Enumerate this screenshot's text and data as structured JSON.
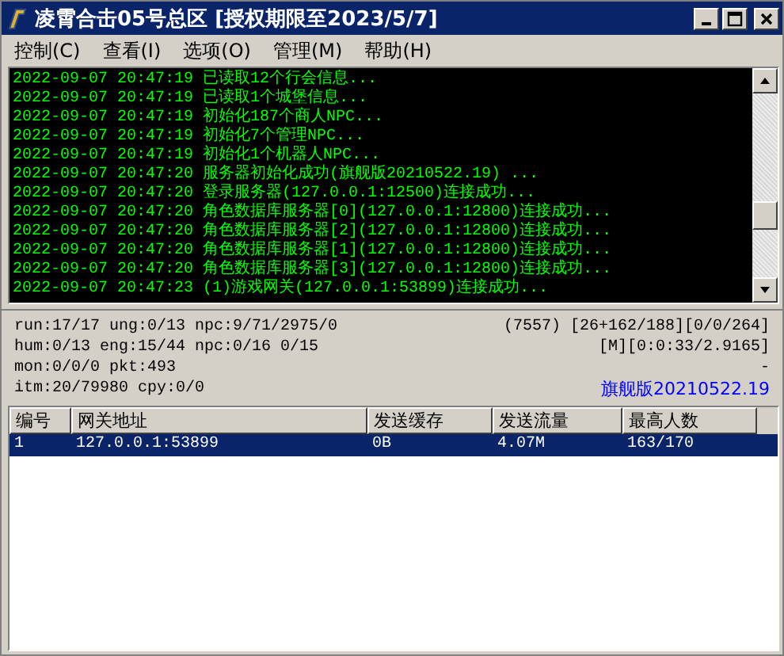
{
  "window": {
    "title": "凌霄合击05号总区 [授权期限至2023/5/7]"
  },
  "menu": [
    {
      "label": "控制(C)"
    },
    {
      "label": "查看(I)"
    },
    {
      "label": "选项(O)"
    },
    {
      "label": "管理(M)"
    },
    {
      "label": "帮助(H)"
    }
  ],
  "log": [
    {
      "time": "2022-09-07 20:47:19",
      "message": "已读取12个行会信息..."
    },
    {
      "time": "2022-09-07 20:47:19",
      "message": "已读取1个城堡信息..."
    },
    {
      "time": "2022-09-07 20:47:19",
      "message": "初始化187个商人NPC..."
    },
    {
      "time": "2022-09-07 20:47:19",
      "message": "初始化7个管理NPC..."
    },
    {
      "time": "2022-09-07 20:47:19",
      "message": "初始化1个机器人NPC..."
    },
    {
      "time": "2022-09-07 20:47:20",
      "message": "服务器初始化成功(旗舰版20210522.19) ..."
    },
    {
      "time": "2022-09-07 20:47:20",
      "message": "登录服务器(127.0.0.1:12500)连接成功..."
    },
    {
      "time": "2022-09-07 20:47:20",
      "message": "角色数据库服务器[0](127.0.0.1:12800)连接成功..."
    },
    {
      "time": "2022-09-07 20:47:20",
      "message": "角色数据库服务器[2](127.0.0.1:12800)连接成功..."
    },
    {
      "time": "2022-09-07 20:47:20",
      "message": "角色数据库服务器[1](127.0.0.1:12800)连接成功..."
    },
    {
      "time": "2022-09-07 20:47:20",
      "message": "角色数据库服务器[3](127.0.0.1:12800)连接成功..."
    },
    {
      "time": "2022-09-07 20:47:23",
      "message": "(1)游戏网关(127.0.0.1:53899)连接成功..."
    }
  ],
  "status": {
    "left": [
      "run:17/17 ung:0/13 npc:9/71/2975/0",
      "hum:0/13 eng:15/44 npc:0/16 0/15",
      "mon:0/0/0 pkt:493",
      "itm:20/79980 cpy:0/0"
    ],
    "right": [
      "(7557) [26+162/188][0/0/264]",
      "[M][0:0:33/2.9165]",
      "-"
    ],
    "version_label": "旗舰版",
    "version": "20210522.19"
  },
  "table": {
    "columns": [
      "编号",
      "网关地址",
      "发送缓存",
      "发送流量",
      "最高人数"
    ],
    "rows": [
      {
        "cells": [
          "1",
          "127.0.0.1:53899",
          "0B",
          "4.07M",
          "163/170"
        ],
        "selected": true
      }
    ]
  }
}
